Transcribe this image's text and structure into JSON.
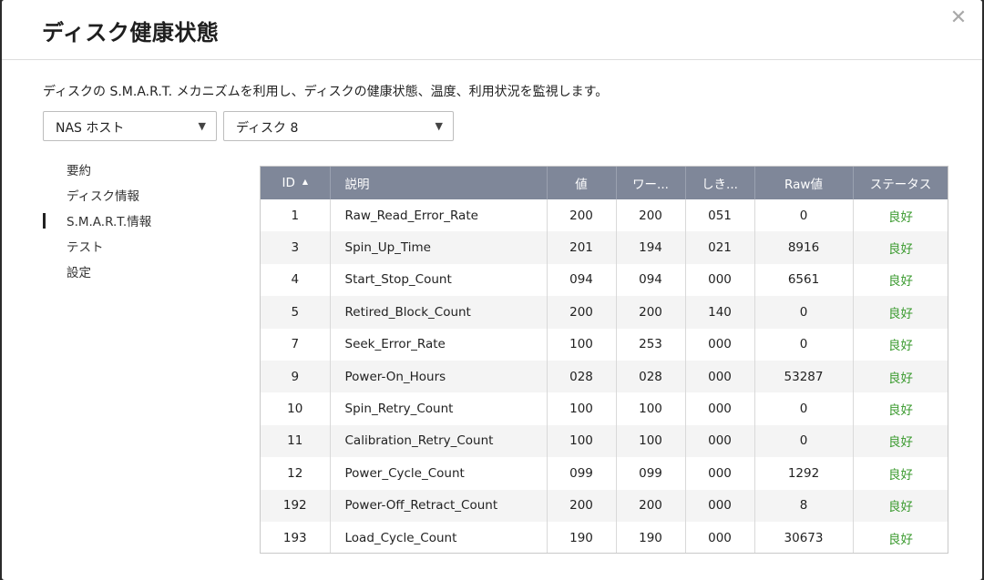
{
  "dialog": {
    "title": "ディスク健康状態",
    "close_label": "✕",
    "description": "ディスクの S.M.A.R.T. メカニズムを利用し、ディスクの健康状態、温度、利用状況を監視します。"
  },
  "selects": {
    "host": {
      "value": "NAS ホスト"
    },
    "disk": {
      "value": "ディスク 8"
    }
  },
  "sidenav": {
    "items": [
      {
        "label": "要約"
      },
      {
        "label": "ディスク情報"
      },
      {
        "label": "S.M.A.R.T.情報"
      },
      {
        "label": "テスト"
      },
      {
        "label": "設定"
      }
    ],
    "active": "S.M.A.R.T.情報"
  },
  "table": {
    "headers": [
      "ID",
      "説明",
      "値",
      "ワー...",
      "しき...",
      "Raw値",
      "ステータス"
    ],
    "rows": [
      [
        "1",
        "Raw_Read_Error_Rate",
        "200",
        "200",
        "051",
        "0",
        "良好"
      ],
      [
        "3",
        "Spin_Up_Time",
        "201",
        "194",
        "021",
        "8916",
        "良好"
      ],
      [
        "4",
        "Start_Stop_Count",
        "094",
        "094",
        "000",
        "6561",
        "良好"
      ],
      [
        "5",
        "Retired_Block_Count",
        "200",
        "200",
        "140",
        "0",
        "良好"
      ],
      [
        "7",
        "Seek_Error_Rate",
        "100",
        "253",
        "000",
        "0",
        "良好"
      ],
      [
        "9",
        "Power-On_Hours",
        "028",
        "028",
        "000",
        "53287",
        "良好"
      ],
      [
        "10",
        "Spin_Retry_Count",
        "100",
        "100",
        "000",
        "0",
        "良好"
      ],
      [
        "11",
        "Calibration_Retry_Count",
        "100",
        "100",
        "000",
        "0",
        "良好"
      ],
      [
        "12",
        "Power_Cycle_Count",
        "099",
        "099",
        "000",
        "1292",
        "良好"
      ],
      [
        "192",
        "Power-Off_Retract_Count",
        "200",
        "200",
        "000",
        "8",
        "良好"
      ],
      [
        "193",
        "Load_Cycle_Count",
        "190",
        "190",
        "000",
        "30673",
        "良好"
      ]
    ]
  },
  "colors": {
    "header_bg": "#7f8799",
    "status_good": "#3a9a2e"
  }
}
